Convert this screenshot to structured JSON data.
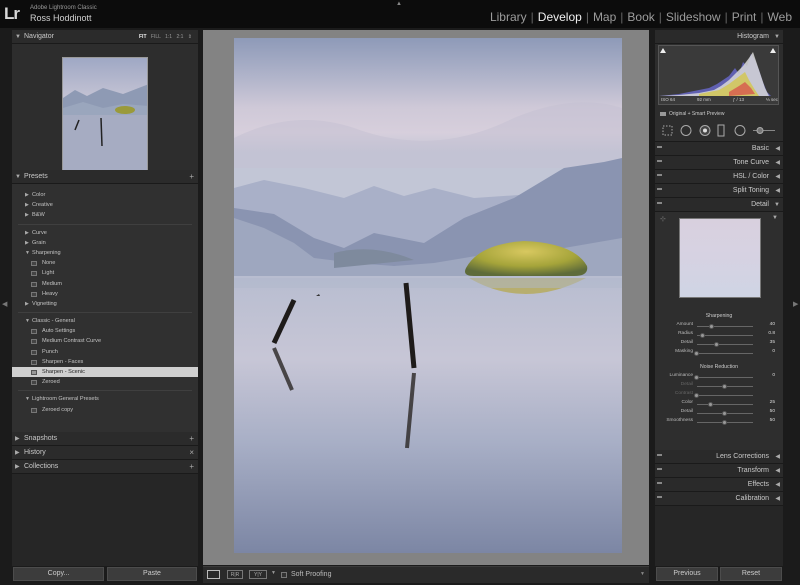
{
  "app": {
    "logo": "Lr",
    "app_name": "Adobe Lightroom Classic",
    "user_name": "Ross Hoddinott"
  },
  "modules": [
    {
      "label": "Library",
      "active": false
    },
    {
      "label": "Develop",
      "active": true
    },
    {
      "label": "Map",
      "active": false
    },
    {
      "label": "Book",
      "active": false
    },
    {
      "label": "Slideshow",
      "active": false
    },
    {
      "label": "Print",
      "active": false
    },
    {
      "label": "Web",
      "active": false
    }
  ],
  "navigator": {
    "title": "Navigator",
    "zoom_options": [
      "FIT",
      "FILL",
      "1:1",
      "2:1"
    ],
    "zoom_selected": "FIT"
  },
  "presets": {
    "title": "Presets",
    "add": "+",
    "groups": [
      {
        "label": "Color",
        "open": false
      },
      {
        "label": "Creative",
        "open": false
      },
      {
        "label": "B&W",
        "open": false
      }
    ],
    "groups2": [
      {
        "label": "Curve",
        "open": false
      },
      {
        "label": "Grain",
        "open": false
      },
      {
        "label": "Sharpening",
        "open": true
      }
    ],
    "sharpening_items": [
      "None",
      "Light",
      "Medium",
      "Heavy"
    ],
    "vignetting": "Vignetting",
    "classic_group": "Classic - General",
    "classic_items": [
      "Auto Settings",
      "Medium Contrast Curve",
      "Punch",
      "Sharpen - Faces",
      "Sharpen - Scenic",
      "Zeroed"
    ],
    "selected": "Sharpen - Scenic",
    "lr_group": "Lightroom General Presets",
    "lr_items": [
      "Zeroed copy"
    ]
  },
  "snapshots": {
    "title": "Snapshots",
    "action": "+"
  },
  "history": {
    "title": "History",
    "action": "×"
  },
  "collections": {
    "title": "Collections",
    "action": "+"
  },
  "buttons": {
    "copy": "Copy...",
    "paste": "Paste",
    "previous": "Previous",
    "reset": "Reset"
  },
  "toolbar": {
    "soft_proofing": "Soft Proofing",
    "compare_label": "Y|Y"
  },
  "histogram": {
    "title": "Histogram",
    "iso": "ISO 64",
    "focal": "92 mm",
    "aperture": "ƒ / 13",
    "shutter": "⅓ sec",
    "preview_status": "Original + Smart Preview"
  },
  "right_panels": [
    "Basic",
    "Tone Curve",
    "HSL / Color",
    "Split Toning",
    "Detail"
  ],
  "right_panels_bottom": [
    "Lens Corrections",
    "Transform",
    "Effects",
    "Calibration"
  ],
  "detail": {
    "sharpening_title": "Sharpening",
    "sharpening": [
      {
        "label": "Amount",
        "value": "40",
        "pct": 0.27,
        "disabled": false
      },
      {
        "label": "Radius",
        "value": "0.8",
        "pct": 0.1,
        "disabled": false
      },
      {
        "label": "Detail",
        "value": "35",
        "pct": 0.35,
        "disabled": false
      },
      {
        "label": "Masking",
        "value": "0",
        "pct": 0.0,
        "disabled": false
      }
    ],
    "noise_title": "Noise Reduction",
    "noise": [
      {
        "label": "Luminance",
        "value": "0",
        "pct": 0.0,
        "disabled": false
      },
      {
        "label": "Detail",
        "value": "",
        "pct": 0.5,
        "disabled": true
      },
      {
        "label": "Contrast",
        "value": "",
        "pct": 0.0,
        "disabled": true
      },
      {
        "label": "Color",
        "value": "25",
        "pct": 0.25,
        "disabled": false
      },
      {
        "label": "Detail",
        "value": "50",
        "pct": 0.5,
        "disabled": false
      },
      {
        "label": "Smoothness",
        "value": "50",
        "pct": 0.5,
        "disabled": false
      }
    ]
  },
  "colors": {
    "selection": "#cfcfcf",
    "panel": "#262626",
    "center_bg": "#838383"
  }
}
